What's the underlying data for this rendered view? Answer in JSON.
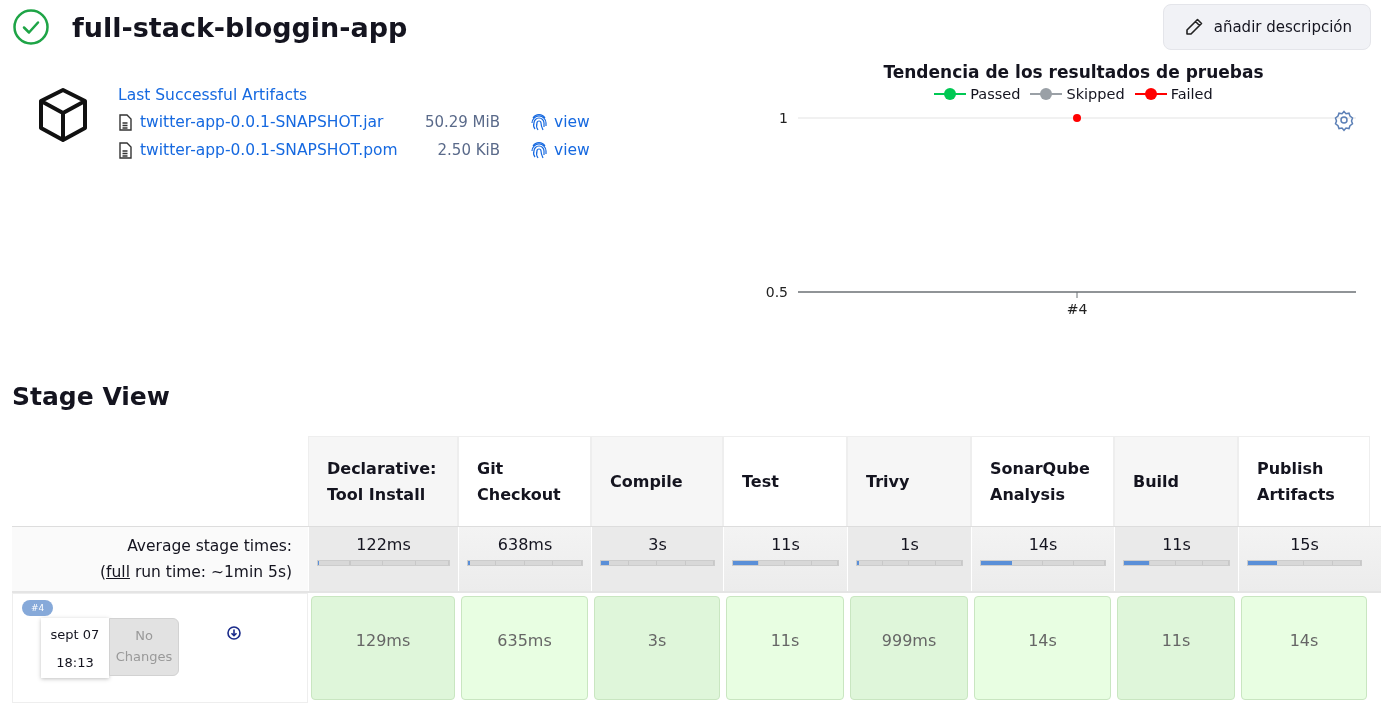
{
  "job": {
    "title": "full-stack-bloggin-app"
  },
  "description_button": {
    "label": "añadir descripción"
  },
  "artifacts": {
    "heading": "Last Successful Artifacts",
    "files": [
      {
        "name": "twitter-app-0.0.1-SNAPSHOT.jar",
        "size": "50.29 MiB",
        "action": "view"
      },
      {
        "name": "twitter-app-0.0.1-SNAPSHOT.pom",
        "size": "2.50 KiB",
        "action": "view"
      }
    ]
  },
  "test_trend": {
    "chart_data": {
      "type": "line",
      "title": "Tendencia de los resultados de pruebas",
      "categories": [
        "#4"
      ],
      "ylim": [
        0.5,
        1
      ],
      "yticks": [
        0.5,
        1
      ],
      "series": [
        {
          "name": "Passed",
          "color": "#00c853",
          "values": [
            null
          ]
        },
        {
          "name": "Skipped",
          "color": "#9aa0a6",
          "values": [
            null
          ]
        },
        {
          "name": "Failed",
          "color": "#ff0000",
          "values": [
            1
          ],
          "marker": true
        }
      ]
    }
  },
  "stage_view": {
    "title": "Stage View",
    "average_label": "Average stage times:",
    "full_run": {
      "prefix": "(",
      "link": "full",
      "suffix": " run time: ~1min 5s)"
    },
    "stages": [
      {
        "name": "Declarative: Tool Install",
        "average": "122ms",
        "level": 0.01
      },
      {
        "name": "Git Checkout",
        "average": "638ms",
        "level": 0.02
      },
      {
        "name": "Compile",
        "average": "3s",
        "level": 0.07
      },
      {
        "name": "Test",
        "average": "11s",
        "level": 0.24
      },
      {
        "name": "Trivy",
        "average": "1s",
        "level": 0.02
      },
      {
        "name": "SonarQube Analysis",
        "average": "14s",
        "level": 0.25
      },
      {
        "name": "Build",
        "average": "11s",
        "level": 0.24
      },
      {
        "name": "Publish Artifacts",
        "average": "15s",
        "level": 0.26
      }
    ],
    "runs": [
      {
        "badge": "#4",
        "date": "sept 07",
        "time": "18:13",
        "changes": "No Changes",
        "durations": [
          "129ms",
          "635ms",
          "3s",
          "11s",
          "999ms",
          "14s",
          "11s",
          "14s"
        ]
      }
    ]
  }
}
